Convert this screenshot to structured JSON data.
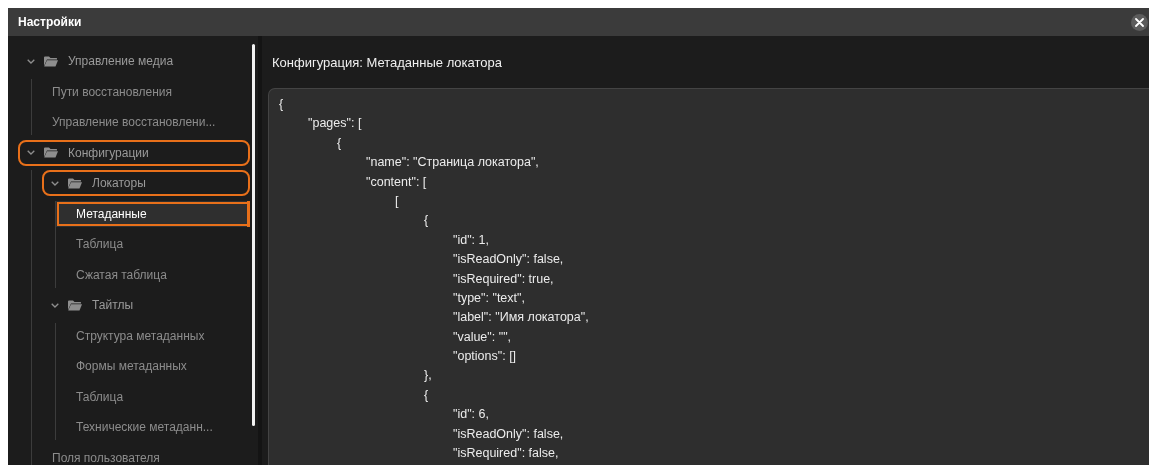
{
  "window": {
    "title": "Настройки"
  },
  "sidebar": {
    "items": [
      {
        "label": "Управление медиа",
        "kind": "folder",
        "expanded": true,
        "selected": false,
        "highlighted": false,
        "children": [
          {
            "label": "Пути восстановления",
            "kind": "leaf",
            "selected": false,
            "highlighted": false
          },
          {
            "label": "Управление восстановлени...",
            "kind": "leaf",
            "selected": false,
            "highlighted": false
          }
        ]
      },
      {
        "label": "Конфигурации",
        "kind": "folder",
        "expanded": true,
        "selected": false,
        "highlighted": true,
        "children": [
          {
            "label": "Локаторы",
            "kind": "folder",
            "expanded": true,
            "selected": false,
            "highlighted": true,
            "children": [
              {
                "label": "Метаданные",
                "kind": "leaf",
                "selected": true,
                "highlighted": true
              },
              {
                "label": "Таблица",
                "kind": "leaf",
                "selected": false,
                "highlighted": false
              },
              {
                "label": "Сжатая таблица",
                "kind": "leaf",
                "selected": false,
                "highlighted": false
              }
            ]
          },
          {
            "label": "Тайтлы",
            "kind": "folder",
            "expanded": true,
            "selected": false,
            "highlighted": false,
            "children": [
              {
                "label": "Структура метаданных",
                "kind": "leaf",
                "selected": false,
                "highlighted": false
              },
              {
                "label": "Формы метаданных",
                "kind": "leaf",
                "selected": false,
                "highlighted": false
              },
              {
                "label": "Таблица",
                "kind": "leaf",
                "selected": false,
                "highlighted": false
              },
              {
                "label": "Технические метаданн...",
                "kind": "leaf",
                "selected": false,
                "highlighted": false
              }
            ]
          },
          {
            "label": "Поля пользователя",
            "kind": "leaf",
            "selected": false,
            "highlighted": false
          }
        ]
      }
    ]
  },
  "content": {
    "heading": "Конфигурация: Метаданные локатора",
    "code_lines": [
      "{",
      "\t\"pages\": [",
      "\t\t{",
      "\t\t\t\"name\": \"Страница локатора\",",
      "\t\t\t\"content\": [",
      "\t\t\t\t[",
      "\t\t\t\t\t{",
      "\t\t\t\t\t\t\"id\": 1,",
      "\t\t\t\t\t\t\"isReadOnly\": false,",
      "\t\t\t\t\t\t\"isRequired\": true,",
      "\t\t\t\t\t\t\"type\": \"text\",",
      "\t\t\t\t\t\t\"label\": \"Имя локатора\",",
      "\t\t\t\t\t\t\"value\": \"\",",
      "\t\t\t\t\t\t\"options\": []",
      "\t\t\t\t\t},",
      "\t\t\t\t\t{",
      "\t\t\t\t\t\t\"id\": 6,",
      "\t\t\t\t\t\t\"isReadOnly\": false,",
      "\t\t\t\t\t\t\"isRequired\": false,"
    ]
  }
}
